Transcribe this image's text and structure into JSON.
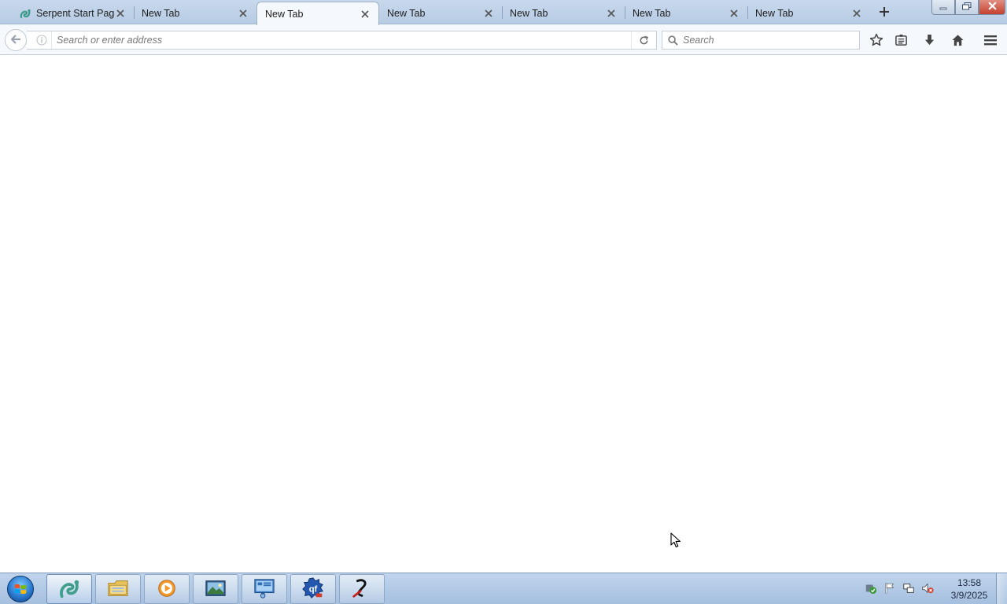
{
  "browser": {
    "tabs": [
      {
        "label": "Serpent Start Page",
        "icon": "serpent-icon",
        "active": false
      },
      {
        "label": "New Tab",
        "active": false
      },
      {
        "label": "New Tab",
        "active": true
      },
      {
        "label": "New Tab",
        "active": false
      },
      {
        "label": "New Tab",
        "active": false
      },
      {
        "label": "New Tab",
        "active": false
      },
      {
        "label": "New Tab",
        "active": false
      }
    ],
    "urlbar": {
      "placeholder": "Search or enter address",
      "value": ""
    },
    "searchbar": {
      "placeholder": "Search",
      "value": ""
    },
    "toolbar_icons": [
      "bookmark-star-icon",
      "reading-list-icon",
      "download-icon",
      "home-icon",
      "menu-icon"
    ]
  },
  "taskbar": {
    "apps": [
      "serpent-browser-icon",
      "file-explorer-icon",
      "media-player-icon",
      "photo-viewer-icon",
      "control-panel-icon",
      "qf-app-icon",
      "snake-app-icon"
    ],
    "tray_icons": [
      "security-icon",
      "action-center-flag-icon",
      "network-icon",
      "volume-muted-icon"
    ],
    "clock": {
      "time": "13:58",
      "date": "3/9/2025"
    }
  },
  "colors": {
    "tabstrip": "#c9d9ec",
    "navbar": "#f5f8fc",
    "taskbar": "#b3cbe6"
  }
}
